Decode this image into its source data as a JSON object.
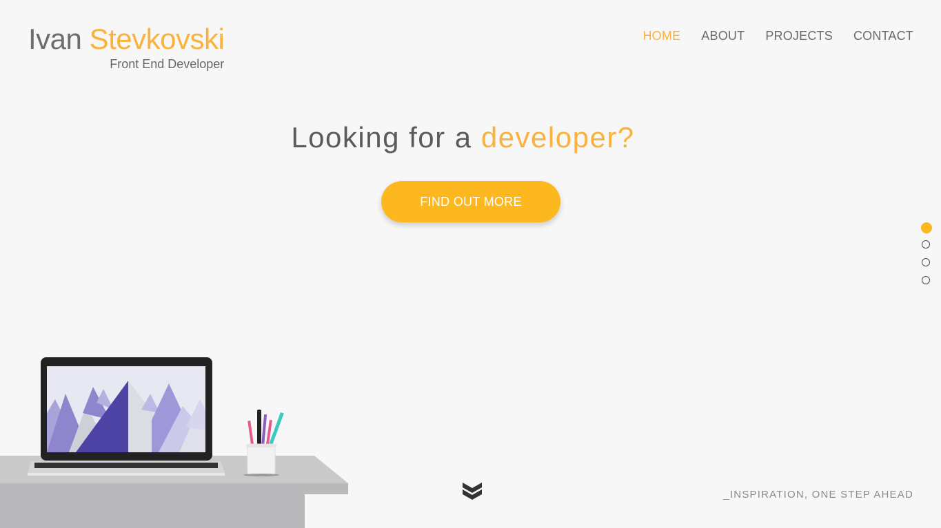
{
  "logo": {
    "first_name": "Ivan",
    "last_name": "Stevkovski",
    "subtitle": "Front End Developer"
  },
  "nav": {
    "items": [
      {
        "label": "HOME",
        "active": true
      },
      {
        "label": "ABOUT",
        "active": false
      },
      {
        "label": "PROJECTS",
        "active": false
      },
      {
        "label": "CONTACT",
        "active": false
      }
    ]
  },
  "hero": {
    "title_prefix": "Looking for a ",
    "title_accent": "developer?",
    "cta_label": "FIND OUT MORE"
  },
  "side_nav": {
    "dots": [
      {
        "active": true
      },
      {
        "active": false
      },
      {
        "active": false
      },
      {
        "active": false
      }
    ]
  },
  "scroll": {
    "icon": "double-chevron-down-icon"
  },
  "footer": {
    "tagline": "_INSPIRATION, ONE STEP AHEAD"
  },
  "colors": {
    "accent": "#fbb23d",
    "button": "#fdb71f",
    "background": "#f7f7f7",
    "text": "#6a6a6a"
  }
}
